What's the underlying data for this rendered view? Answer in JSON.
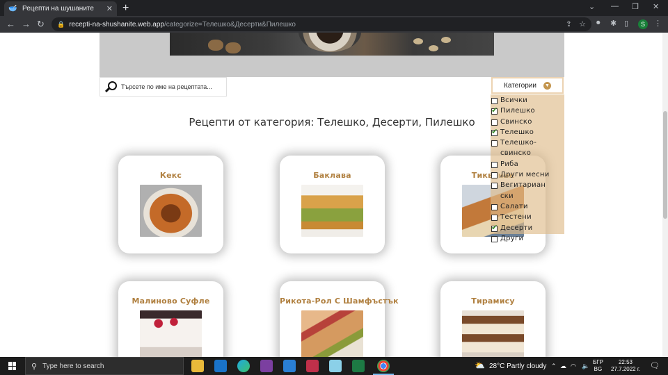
{
  "browser": {
    "tab_title": "Рецепти на шушаните",
    "url_host": "recepti-na-shushanite.web.app",
    "url_path": "/categorize=Телешко&Десерти&Пилешко",
    "profile_initial": "S"
  },
  "search": {
    "placeholder": "Търсете по име на рецептата..."
  },
  "categories": {
    "button_label": "Категории",
    "items": [
      {
        "label": "Всички",
        "checked": false
      },
      {
        "label": "Пилешко",
        "checked": true
      },
      {
        "label": "Свинско",
        "checked": false
      },
      {
        "label": "Телешко",
        "checked": true
      },
      {
        "label": "Телешко-свинско",
        "checked": false
      },
      {
        "label": "Риба",
        "checked": false
      },
      {
        "label": "Други месни",
        "checked": false
      },
      {
        "label": "Вегитариански",
        "checked": false
      },
      {
        "label": "Салати",
        "checked": false
      },
      {
        "label": "Тестени",
        "checked": false
      },
      {
        "label": "Десерти",
        "checked": true
      },
      {
        "label": "Други",
        "checked": false
      }
    ]
  },
  "heading": "Рецепти от категория: Телешко, Десерти, Пилешко",
  "recipes": [
    {
      "title": "Кекс",
      "image": "bundt-cake"
    },
    {
      "title": "Баклава",
      "image": "baklava"
    },
    {
      "title": "Тиквеник",
      "image": "pastry"
    },
    {
      "title": "Малиново Суфле",
      "image": "raspberry-souffle"
    },
    {
      "title": "Рикота-Рол С Шамфъстък",
      "image": "ricotta-roll"
    },
    {
      "title": "Тирамису",
      "image": "tiramisu"
    }
  ],
  "taskbar": {
    "search_placeholder": "Type here to search",
    "weather": "28°C  Partly cloudy",
    "lang_top": "БГР",
    "lang_bottom": "BG",
    "time": "22:53",
    "date": "27.7.2022 г."
  }
}
